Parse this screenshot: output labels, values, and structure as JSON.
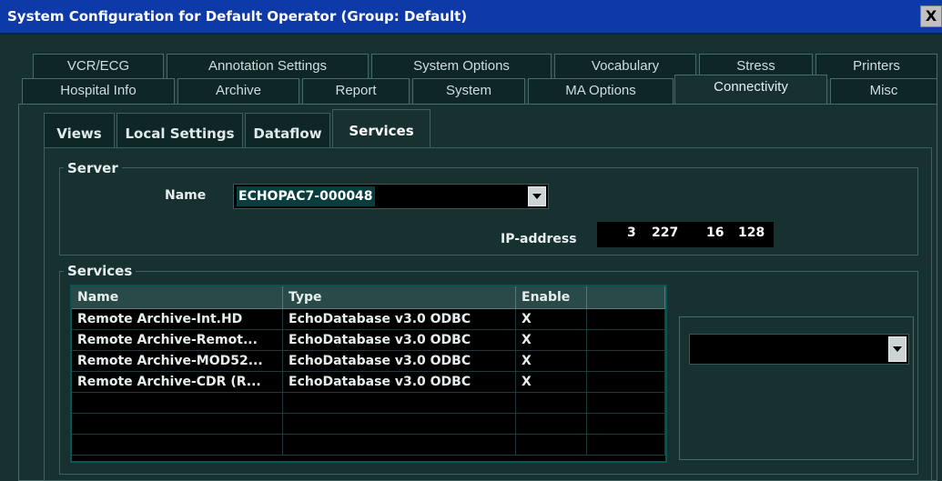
{
  "window": {
    "title": "System Configuration for Default Operator (Group: Default)",
    "close_label": "X"
  },
  "tabs_row1": [
    {
      "label": "VCR/ECG"
    },
    {
      "label": "Annotation Settings"
    },
    {
      "label": "System Options"
    },
    {
      "label": "Vocabulary"
    },
    {
      "label": "Stress"
    },
    {
      "label": "Printers"
    }
  ],
  "tabs_row2": [
    {
      "label": "Hospital Info"
    },
    {
      "label": "Archive"
    },
    {
      "label": "Report"
    },
    {
      "label": "System"
    },
    {
      "label": "MA Options"
    },
    {
      "label": "Connectivity",
      "active": true
    },
    {
      "label": "Misc"
    }
  ],
  "subtabs": [
    {
      "label": "Views"
    },
    {
      "label": "Local Settings"
    },
    {
      "label": "Dataflow"
    },
    {
      "label": "Services",
      "active": true
    }
  ],
  "server": {
    "group_label": "Server",
    "name_label": "Name",
    "name_value": "ECHOPAC7-000048",
    "ip_label": "IP-address",
    "ip": [
      "3",
      "227",
      "16",
      "128"
    ]
  },
  "services": {
    "group_label": "Services",
    "columns": [
      "Name",
      "Type",
      "Enable",
      ""
    ],
    "rows": [
      [
        "Remote Archive-Int.HD",
        "EchoDatabase v3.0 ODBC",
        "X"
      ],
      [
        "Remote Archive-Remot...",
        "EchoDatabase v3.0 ODBC",
        "X"
      ],
      [
        "Remote Archive-MOD52...",
        "EchoDatabase v3.0 ODBC",
        "X"
      ],
      [
        "Remote Archive-CDR (R...",
        "EchoDatabase v3.0 ODBC",
        "X"
      ]
    ],
    "selector_value": ""
  }
}
